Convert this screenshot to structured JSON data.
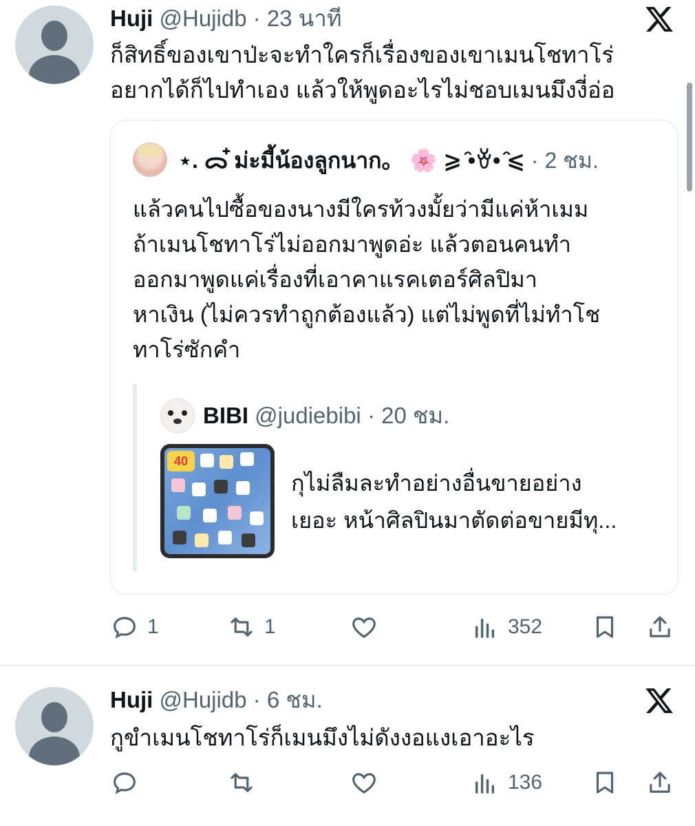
{
  "tweets": [
    {
      "author": {
        "name": "Huji",
        "handle": "@Hujidb",
        "time": "23 นาที"
      },
      "text": "ก็สิทธิ์ของเขาป่ะจะทำใครก็เรื่องของเขาเมนโชทาโร่\nอยากได้ก็ไปทำเอง แล้วให้พูดอะไรไม่ชอบเมนมึงงี่อ่อ",
      "quote": {
        "author": {
          "name": "⋆. ᯅ ໋ม่ะมี้น้องลูกนาก。 🌸 ⩾ ̑•ꈊ• ̑⩽",
          "time": "2 ชม."
        },
        "text": "แล้วคนไปซื้อของนางมีใครท้วงมั้ยว่ามีแค่ห้าเมม\nถ้าเมนโชทาโร่ไม่ออกมาพูดอ่ะ แล้วตอนคนทำ\nออกมาพูดแค่เรื่องที่เอาคาแรคเตอร์ศิลปิมา\nหาเงิน (ไม่ควรทำถูกต้องแล้ว) แต่ไม่พูดที่ไม่ทำโช\nทาโร่ซักคำ",
        "nested": {
          "author": {
            "name": "BIBI",
            "handle": "@judiebibi",
            "time": "20 ชม."
          },
          "thumb_badge": "40",
          "text": "กุไม่ลืมละทำอย่างอื่นขายอย่าง\nเยอะ หน้าศิลปินมาตัดต่อขายมีทุ..."
        }
      },
      "stats": {
        "replies": "1",
        "reposts": "1",
        "likes": "",
        "views": "352"
      }
    },
    {
      "author": {
        "name": "Huji",
        "handle": "@Hujidb",
        "time": "6 ชม."
      },
      "text": "กูขำเมนโชทาโร่ก็เมนมึงไม่ดังงอแงเอาอะไร",
      "stats": {
        "replies": "",
        "reposts": "",
        "likes": "",
        "views": "136"
      }
    }
  ],
  "separator": "·",
  "icons": [
    "x-logo-icon",
    "reply-icon",
    "repost-icon",
    "like-icon",
    "views-icon",
    "bookmark-icon",
    "share-icon"
  ],
  "colors": {
    "text": "#0f1419",
    "secondary": "#536471",
    "border": "#e1e6ea"
  }
}
